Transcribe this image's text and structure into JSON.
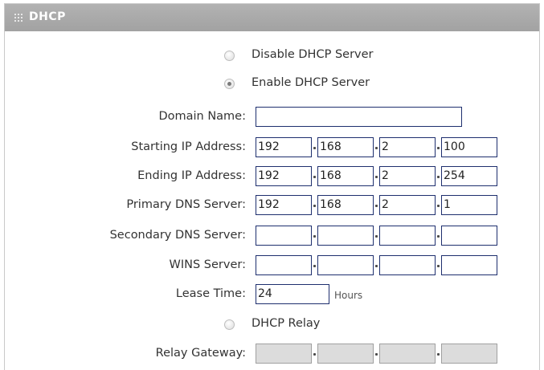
{
  "panel": {
    "title": "DHCP"
  },
  "radios": {
    "disable": {
      "label": "Disable DHCP Server",
      "checked": false
    },
    "enable": {
      "label": "Enable DHCP Server",
      "checked": true
    },
    "relay": {
      "label": "DHCP Relay",
      "checked": false
    }
  },
  "domain": {
    "label": "Domain Name:",
    "value": ""
  },
  "start_ip": {
    "label": "Starting IP Address:",
    "o1": "192",
    "o2": "168",
    "o3": "2",
    "o4": "100"
  },
  "end_ip": {
    "label": "Ending IP Address:",
    "o1": "192",
    "o2": "168",
    "o3": "2",
    "o4": "254"
  },
  "primary_dns": {
    "label": "Primary DNS Server:",
    "o1": "192",
    "o2": "168",
    "o3": "2",
    "o4": "1"
  },
  "secondary_dns": {
    "label": "Secondary DNS Server:",
    "o1": "",
    "o2": "",
    "o3": "",
    "o4": ""
  },
  "wins": {
    "label": "WINS Server:",
    "o1": "",
    "o2": "",
    "o3": "",
    "o4": ""
  },
  "lease": {
    "label": "Lease Time:",
    "value": "24",
    "unit": "Hours"
  },
  "relay_gateway": {
    "label": "Relay Gateway:",
    "o1": "",
    "o2": "",
    "o3": "",
    "o4": ""
  },
  "colors": {
    "titlebar": "#a8a8a8",
    "field_border": "#1e2f6e",
    "disabled_fill": "#dcdcdc"
  }
}
